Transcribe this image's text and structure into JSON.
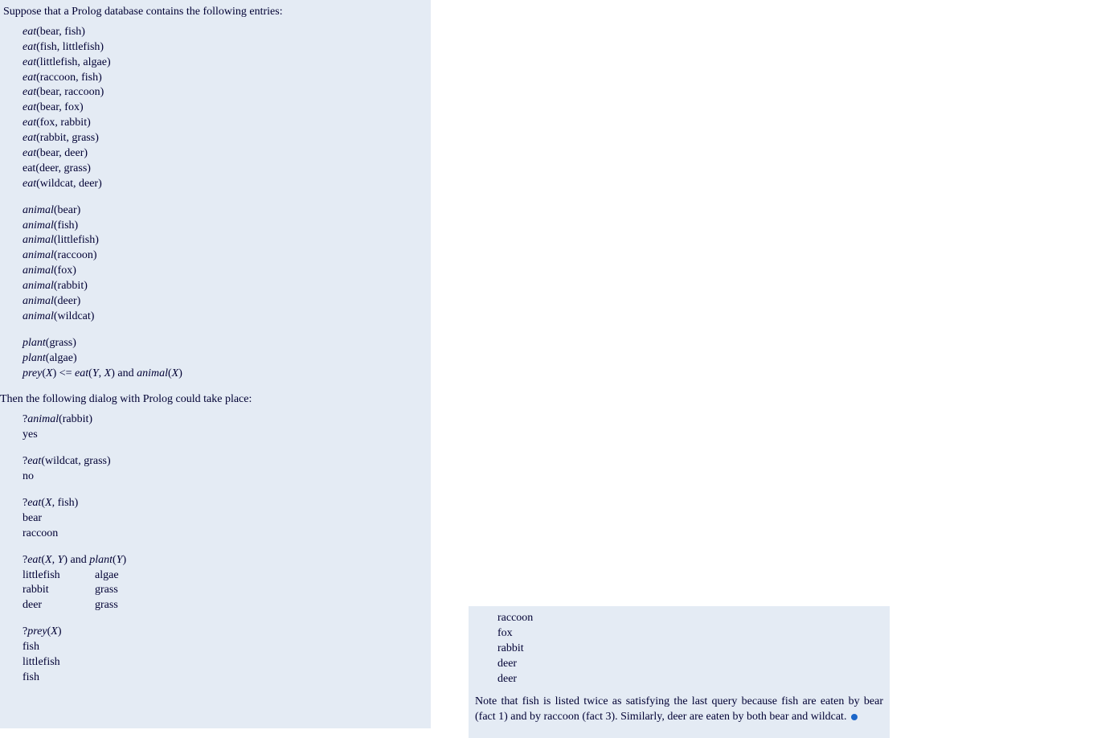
{
  "intro": "Suppose that a Prolog database contains the following entries:",
  "facts": {
    "eat": [
      {
        "pred": "eat",
        "a": "bear",
        "b": "fish",
        "italic": true
      },
      {
        "pred": "eat",
        "a": "fish",
        "b": "littlefish",
        "italic": true
      },
      {
        "pred": "eat",
        "a": "littlefish",
        "b": "algae",
        "italic": true
      },
      {
        "pred": "eat",
        "a": "raccoon",
        "b": "fish",
        "italic": true
      },
      {
        "pred": "eat",
        "a": "bear",
        "b": "raccoon",
        "italic": true
      },
      {
        "pred": "eat",
        "a": "bear",
        "b": "fox",
        "italic": true
      },
      {
        "pred": "eat",
        "a": "fox",
        "b": "rabbit",
        "italic": true
      },
      {
        "pred": "eat",
        "a": "rabbit",
        "b": "grass",
        "italic": true
      },
      {
        "pred": "eat",
        "a": "bear",
        "b": "deer",
        "italic": true
      },
      {
        "pred": "eat",
        "a": "deer",
        "b": "grass",
        "italic": false
      },
      {
        "pred": "eat",
        "a": "wildcat",
        "b": "deer",
        "italic": true
      }
    ],
    "animal": [
      "bear",
      "fish",
      "littlefish",
      "raccoon",
      "fox",
      "rabbit",
      "deer",
      "wildcat"
    ],
    "plant": [
      "grass",
      "algae"
    ],
    "rule_text_parts": {
      "prey": "prey",
      "open": "(",
      "x": "X",
      "close": ")",
      "le": " <= ",
      "eat": "eat",
      "ypair": "(Y, X)",
      "and": " and ",
      "animal": "animal",
      "xclose": "(X)"
    }
  },
  "dialog_intro": "Then the following dialog with Prolog could take place:",
  "dialogs": [
    {
      "query_html": "?<span class='it'>animal</span>(rabbit)",
      "answers": [
        "yes"
      ]
    },
    {
      "query_html": "?<span class='it'>eat</span>(wildcat, grass)",
      "answers": [
        "no"
      ]
    },
    {
      "query_html": "?<span class='it'>eat</span>(<span class='it'>X</span>, fish)",
      "answers": [
        "bear",
        "raccoon"
      ]
    },
    {
      "query_html": "?<span class='it'>eat</span>(<span class='it'>X</span>, <span class='it'>Y</span>) and <span class='it'>plant</span>(<span class='it'>Y</span>)",
      "pairs": [
        [
          "littlefish",
          "algae"
        ],
        [
          "rabbit",
          "grass"
        ],
        [
          "deer",
          "grass"
        ]
      ]
    },
    {
      "query_html": "?<span class='it'>prey</span>(<span class='it'>X</span>)",
      "answers": [
        "fish",
        "littlefish",
        "fish"
      ]
    }
  ],
  "right_results": [
    "raccoon",
    "fox",
    "rabbit",
    "deer",
    "deer"
  ],
  "note": "Note that fish is listed twice as satisfying the last query because fish are eaten by bear (fact 1) and by raccoon (fact 3). Similarly, deer are eaten by both bear and wildcat."
}
